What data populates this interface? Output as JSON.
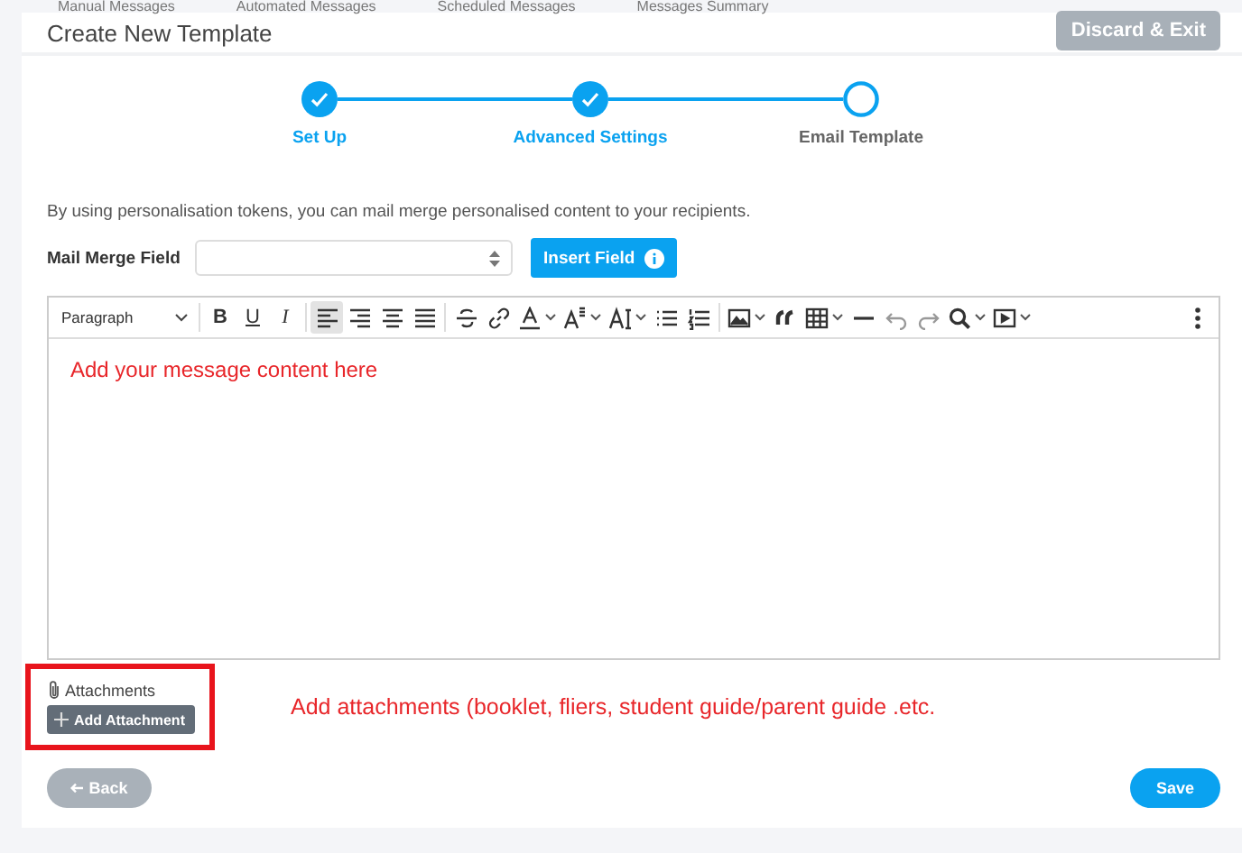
{
  "top_tabs": [
    "Manual Messages",
    "Automated Messages",
    "Scheduled Messages",
    "Messages Summary"
  ],
  "header": {
    "title": "Create New Template",
    "discard_button": "Discard & Exit"
  },
  "steps": [
    {
      "label": "Set Up",
      "done": true
    },
    {
      "label": "Advanced Settings",
      "done": true
    },
    {
      "label": "Email Template",
      "done": false
    }
  ],
  "intro": "By using personalisation tokens, you can mail merge personalised content to your recipients.",
  "mail_merge": {
    "label": "Mail Merge Field",
    "button": "Insert Field"
  },
  "toolbar": [
    {
      "kind": "select",
      "label": "Paragraph"
    },
    {
      "kind": "sep"
    },
    {
      "kind": "letter",
      "label": "B"
    },
    {
      "kind": "letter",
      "label": "U"
    },
    {
      "kind": "letter",
      "label": "I"
    },
    {
      "kind": "sep"
    },
    {
      "kind": "icon",
      "active": true
    },
    {
      "kind": "icon",
      "active": false
    },
    {
      "kind": "icon",
      "active": false
    },
    {
      "kind": "icon",
      "active": false
    },
    {
      "kind": "sep"
    },
    {
      "kind": "icon",
      "active": false
    },
    {
      "kind": "icon",
      "active": false
    },
    {
      "kind": "icon",
      "dropdown": true,
      "active": false
    },
    {
      "kind": "icon",
      "dropdown": true,
      "active": false
    },
    {
      "kind": "icon",
      "dropdown": true,
      "active": false
    },
    {
      "kind": "icon",
      "active": false
    },
    {
      "kind": "icon",
      "active": false
    },
    {
      "kind": "sep"
    },
    {
      "kind": "icon",
      "dropdown": true,
      "active": false
    },
    {
      "kind": "icon",
      "active": false
    },
    {
      "kind": "icon",
      "dropdown": true,
      "active": false
    },
    {
      "kind": "icon",
      "active": false
    },
    {
      "kind": "icon",
      "active": false
    },
    {
      "kind": "icon",
      "active": false
    },
    {
      "kind": "icon",
      "dropdown": true,
      "active": false
    },
    {
      "kind": "icon",
      "dropdown": true,
      "active": false
    },
    {
      "kind": "spacer"
    },
    {
      "kind": "icon",
      "active": false
    }
  ],
  "editor_content": "Add your message content here",
  "attachments": {
    "label": "Attachments",
    "button": "Add Attachment"
  },
  "annotation": "Add attachments (booklet, fliers, student guide/parent guide .etc.",
  "footer": {
    "back_button": "Back",
    "save_button": "Save"
  }
}
